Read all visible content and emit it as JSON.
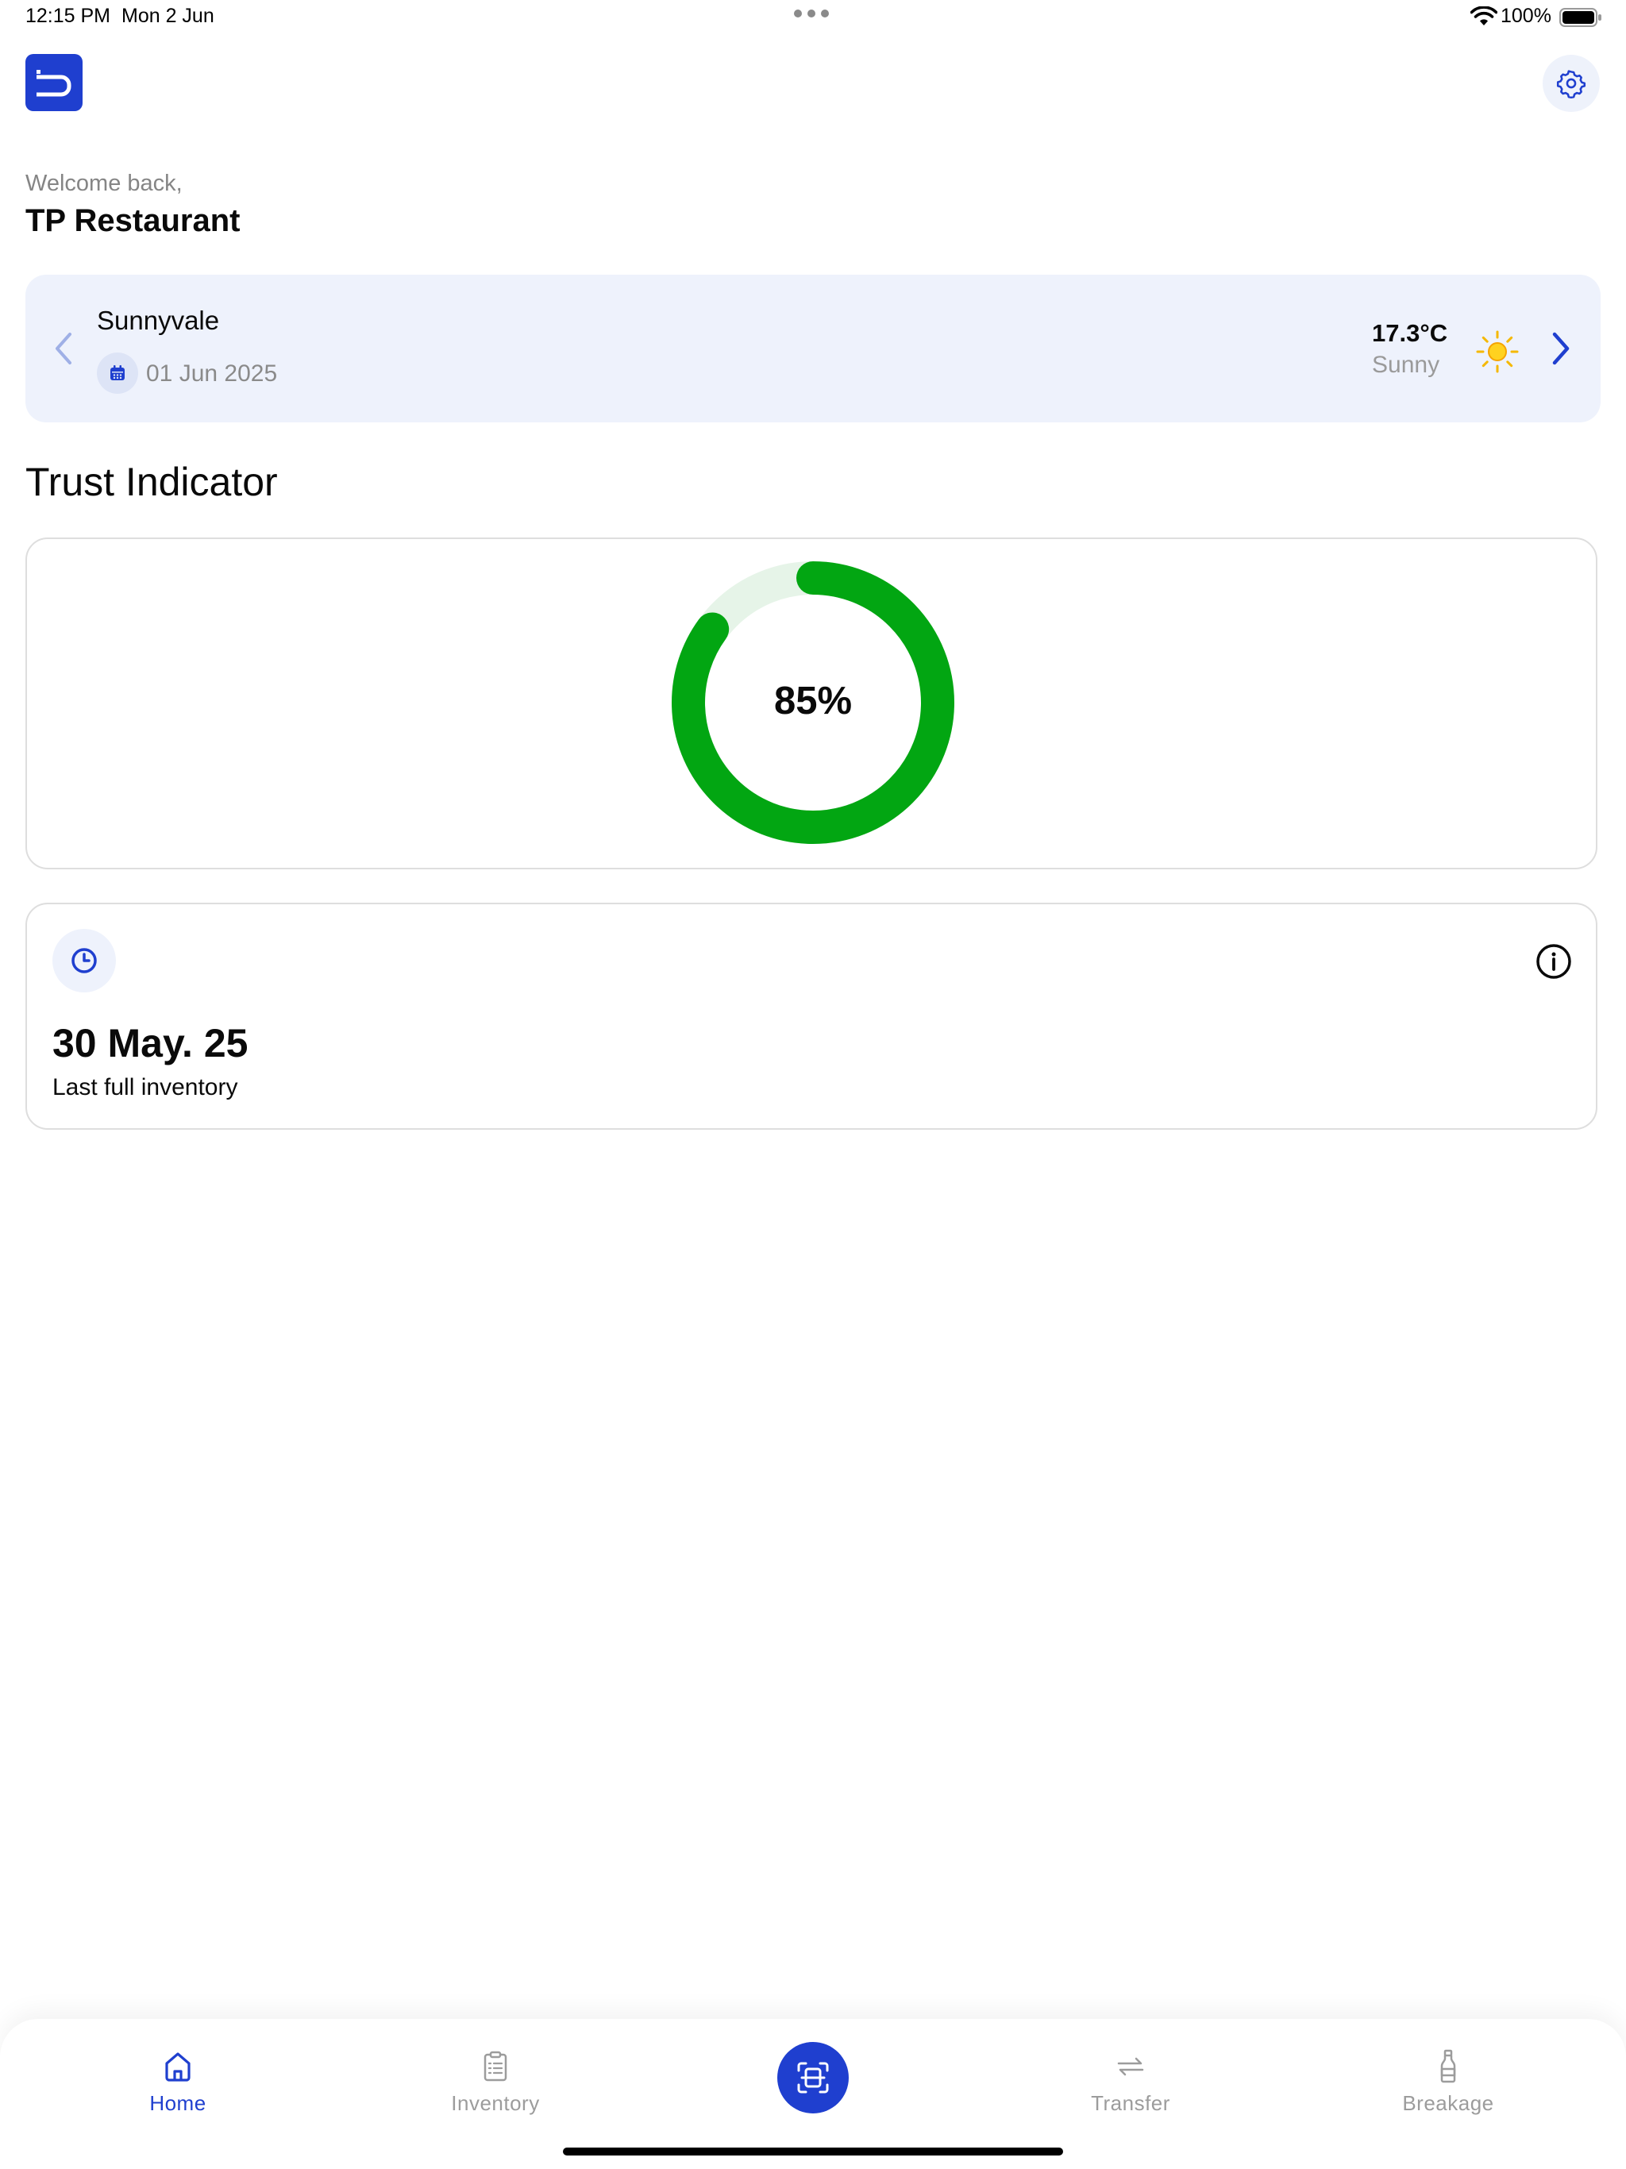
{
  "status_bar": {
    "time": "12:15 PM",
    "date": "Mon 2 Jun",
    "battery_percent": "100%"
  },
  "header": {
    "logo_icon": "app-logo-icon",
    "settings_icon": "gear-icon"
  },
  "greeting": {
    "welcome": "Welcome back,",
    "restaurant_name": "TP Restaurant"
  },
  "location_card": {
    "location": "Sunnyvale",
    "date": "01 Jun 2025",
    "temperature": "17.3°C",
    "weather": "Sunny",
    "weather_icon": "sun-icon"
  },
  "trust_indicator": {
    "title": "Trust Indicator",
    "value_text": "85%",
    "value": 0.85,
    "color": "#02a612",
    "track_color": "#e6f4e8"
  },
  "inventory_card": {
    "date": "30 May. 25",
    "label": "Last full inventory"
  },
  "tab_bar": {
    "tabs": [
      {
        "label": "Home",
        "icon": "home-icon",
        "active": true
      },
      {
        "label": "Inventory",
        "icon": "clipboard-icon",
        "active": false
      },
      {
        "label": "Transfer",
        "icon": "transfer-icon",
        "active": false
      },
      {
        "label": "Breakage",
        "icon": "bottle-icon",
        "active": false
      }
    ],
    "center_button_icon": "scan-icon"
  },
  "colors": {
    "accent": "#1f3fcf",
    "card_bg": "#eef2fc",
    "muted_text": "#8a8a8a"
  }
}
